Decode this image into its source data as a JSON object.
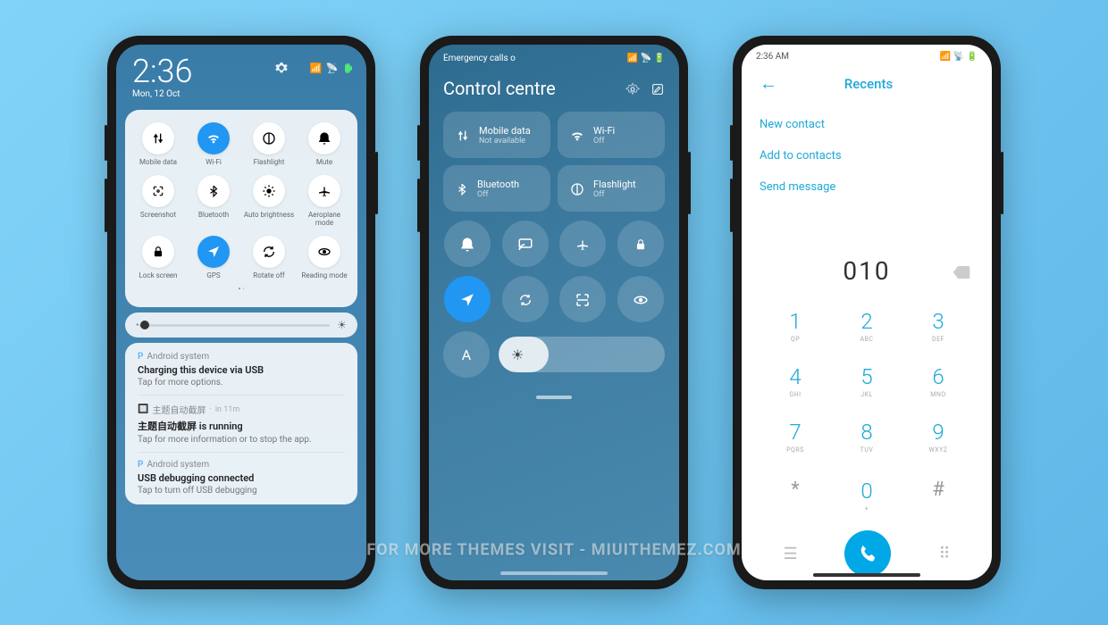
{
  "watermark": "FOR MORE THEMES VISIT - MIUITHEMEZ.COM",
  "phone1": {
    "time": "2:36",
    "date": "Mon, 12 Oct",
    "qs": [
      {
        "label": "Mobile data",
        "icon": "mobile-data",
        "active": false
      },
      {
        "label": "Wi-Fi",
        "icon": "wifi",
        "active": true
      },
      {
        "label": "Flashlight",
        "icon": "flashlight",
        "active": false
      },
      {
        "label": "Mute",
        "icon": "mute",
        "active": false
      },
      {
        "label": "Screenshot",
        "icon": "screenshot",
        "active": false
      },
      {
        "label": "Bluetooth",
        "icon": "bluetooth",
        "active": false
      },
      {
        "label": "Auto brightness",
        "icon": "auto-brightness",
        "active": false
      },
      {
        "label": "Aeroplane mode",
        "icon": "airplane",
        "active": false
      },
      {
        "label": "Lock screen",
        "icon": "lock",
        "active": false
      },
      {
        "label": "GPS",
        "icon": "gps",
        "active": true
      },
      {
        "label": "Rotate off",
        "icon": "rotate",
        "active": false
      },
      {
        "label": "Reading mode",
        "icon": "reading",
        "active": false
      }
    ],
    "notif1": {
      "app": "Android system",
      "title": "Charging this device via USB",
      "sub": "Tap for more options."
    },
    "notif2": {
      "app": "主题自动截屏",
      "time": "in 11m",
      "title": "主题自动截屏 is running",
      "sub": "Tap for more information or to stop the app."
    },
    "notif3": {
      "app": "Android system",
      "title": "USB debugging connected",
      "sub": "Tap to turn off USB debugging"
    }
  },
  "phone2": {
    "emergency": "Emergency calls o",
    "title": "Control centre",
    "tiles": [
      {
        "label": "Mobile data",
        "status": "Not available",
        "icon": "mobile-data"
      },
      {
        "label": "Wi-Fi",
        "status": "Off",
        "icon": "wifi"
      },
      {
        "label": "Bluetooth",
        "status": "Off",
        "icon": "bluetooth"
      },
      {
        "label": "Flashlight",
        "status": "Off",
        "icon": "flashlight"
      }
    ],
    "smallIcons": [
      "bell",
      "cast",
      "airplane",
      "lock",
      "nav",
      "rotate",
      "scan",
      "eye"
    ],
    "auto": "A"
  },
  "phone3": {
    "time": "2:36 AM",
    "header": "Recents",
    "menu": [
      "New contact",
      "Add to contacts",
      "Send message"
    ],
    "number": "010",
    "keys": [
      {
        "n": "1",
        "s": "QP"
      },
      {
        "n": "2",
        "s": "ABC"
      },
      {
        "n": "3",
        "s": "DEF"
      },
      {
        "n": "4",
        "s": "GHI"
      },
      {
        "n": "5",
        "s": "JKL"
      },
      {
        "n": "6",
        "s": "MNO"
      },
      {
        "n": "7",
        "s": "PQRS"
      },
      {
        "n": "8",
        "s": "TUV"
      },
      {
        "n": "9",
        "s": "WXYZ"
      }
    ],
    "star": "*",
    "zero": "0",
    "zeroSub": "+",
    "hash": "#"
  }
}
